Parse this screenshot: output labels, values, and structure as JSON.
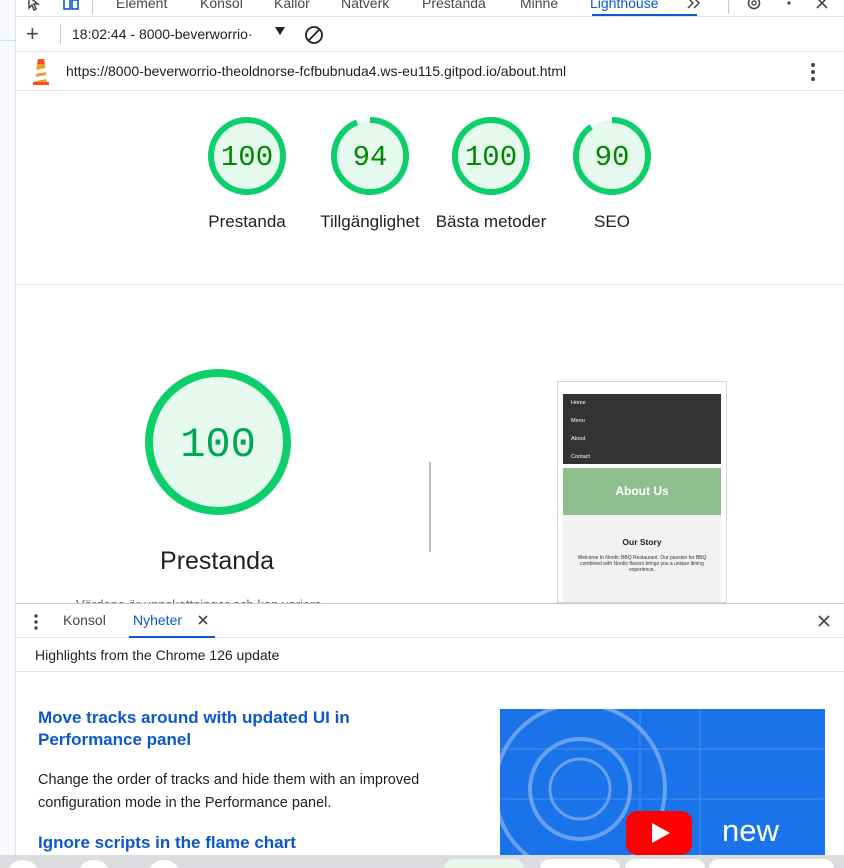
{
  "tabbar": {
    "tabs": [
      "Element",
      "Konsol",
      "Källor",
      "Nätverk",
      "Prestanda",
      "Minne",
      "Lighthouse"
    ],
    "active_tab": "Lighthouse"
  },
  "toolbar": {
    "run_label": "18:02:44 - 8000-beverworrio·"
  },
  "urlbar": {
    "url": "https://8000-beverworrio-theoldnorse-fcfbubnuda4.ws-eu115.gitpod.io/about.html"
  },
  "scores": [
    {
      "value": "100",
      "label": "Prestanda",
      "fraction": 1.0
    },
    {
      "value": "94",
      "label": "Tillgänglighet",
      "fraction": 0.94
    },
    {
      "value": "100",
      "label": "Bästa metoder",
      "fraction": 1.0
    },
    {
      "value": "90",
      "label": "SEO",
      "fraction": 0.9
    }
  ],
  "main_score": {
    "value": "100",
    "title": "Prestanda",
    "description": "Värdena är uppskattningar och kan variera."
  },
  "thumbnail": {
    "nav": [
      "Home",
      "Menu",
      "About",
      "Contact"
    ],
    "hero_title": "About Us",
    "story_title": "Our Story",
    "story_text": "Welcome to Nordic BBQ Restaurant. Our passion for BBQ combined with Nordic flavors brings you a unique dining experience."
  },
  "drawer": {
    "tabs": [
      "Konsol",
      "Nyheter"
    ],
    "active_tab": "Nyheter",
    "highlights": "Highlights from the Chrome 126 update"
  },
  "news": {
    "heading1": "Move tracks around with updated UI in Performance panel",
    "paragraph1": "Change the order of tracks and hide them with an improved configuration mode in the Performance panel.",
    "heading2": "Ignore scripts in the flame chart",
    "image_text": "new"
  },
  "colors": {
    "accent": "#0b57d0",
    "score_green": "#0cce6b",
    "score_text": "#008800",
    "score_bg": "#e5f9ee"
  }
}
